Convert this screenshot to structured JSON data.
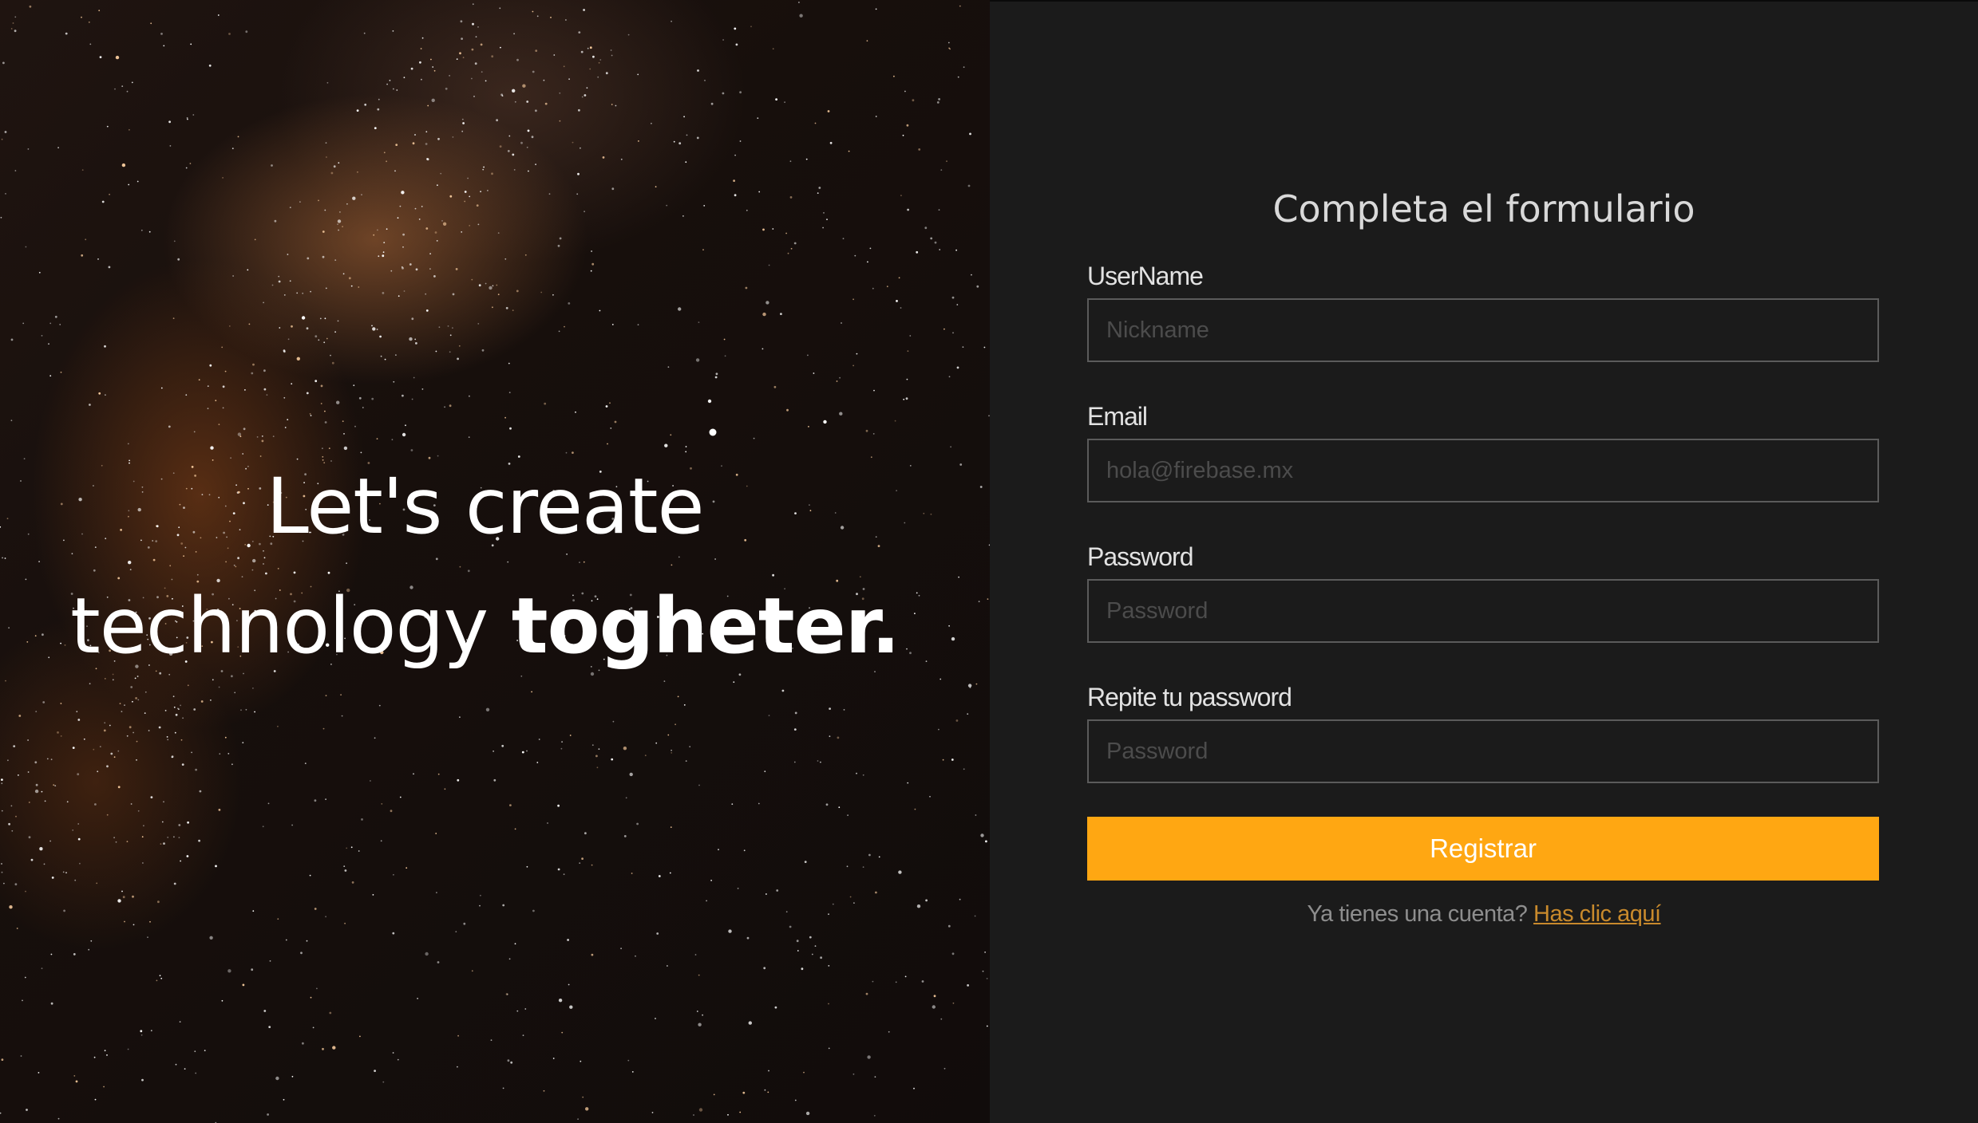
{
  "hero": {
    "line1": "Let's create",
    "line2_regular": "technology",
    "line2_bold": "togheter."
  },
  "form": {
    "title": "Completa el formulario",
    "fields": [
      {
        "label": "UserName",
        "placeholder": "Nickname",
        "type": "text",
        "value": ""
      },
      {
        "label": "Email",
        "placeholder": "hola@firebase.mx",
        "type": "email",
        "value": ""
      },
      {
        "label": "Password",
        "placeholder": "Password",
        "type": "password",
        "value": ""
      },
      {
        "label": "Repite tu password",
        "placeholder": "Password",
        "type": "password",
        "value": ""
      }
    ],
    "submit_label": "Registrar",
    "login_prompt": "Ya tienes una cuenta?",
    "login_link": "Has clic aquí"
  },
  "colors": {
    "accent": "#ffa712",
    "panel_background": "#1b1b1b",
    "link": "#c98a2c"
  }
}
